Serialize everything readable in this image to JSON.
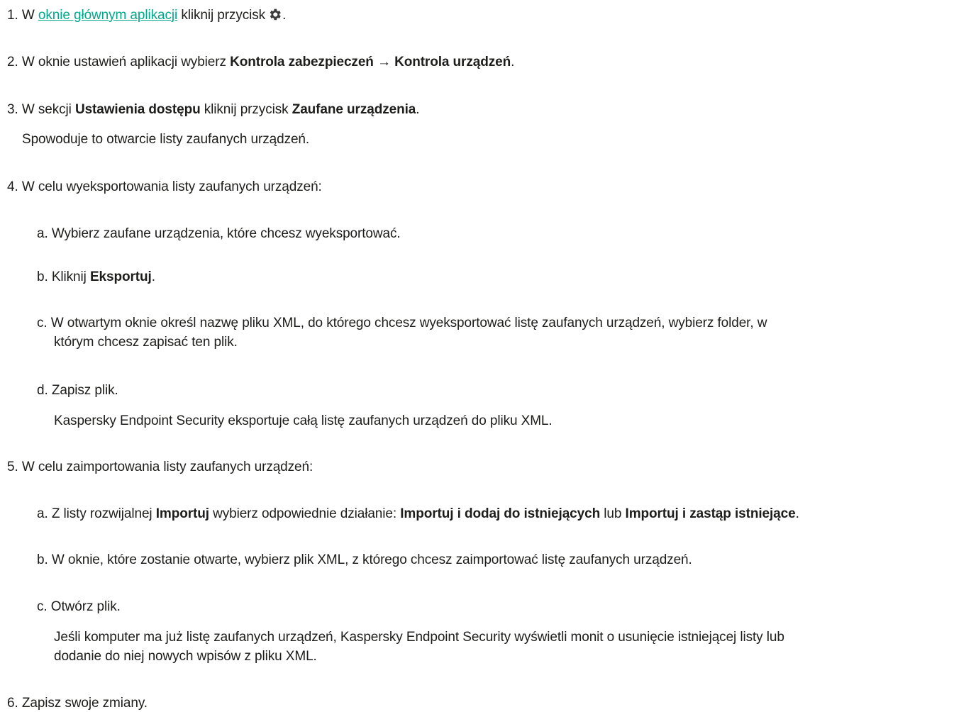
{
  "steps": {
    "s1": {
      "num": "1.",
      "pre": "W",
      "link": "oknie głównym aplikacji",
      "post": "kliknij przycisk",
      "icon": "gear-icon",
      "end": "."
    },
    "s2": {
      "num": "2.",
      "pre": "W oknie ustawień aplikacji wybierz",
      "bold1": "Kontrola zabezpieczeń → Kontrola urządzeń",
      "end": "."
    },
    "s3": {
      "num": "3.",
      "pre": "W sekcji",
      "bold1": "Ustawienia dostępu",
      "mid": "kliknij przycisk",
      "bold2": "Zaufane urządzenia",
      "end": ".",
      "note": "Spowoduje to otwarcie listy zaufanych urządzeń."
    },
    "s4": {
      "num": "4.",
      "text": "W celu wyeksportowania listy zaufanych urządzeń:",
      "a": {
        "num": "a.",
        "text": "Wybierz zaufane urządzenia, które chcesz wyeksportować."
      },
      "b": {
        "num": "b.",
        "pre": "Kliknij",
        "bold1": "Eksportuj",
        "end": "."
      },
      "c": {
        "num": "c.",
        "line1": "W otwartym oknie określ nazwę pliku XML, do którego chcesz wyeksportować listę zaufanych urządzeń, wybierz folder, w",
        "line2": "którym chcesz zapisać ten plik."
      },
      "d": {
        "num": "d.",
        "text": "Zapisz plik.",
        "note": "Kaspersky Endpoint Security eksportuje całą listę zaufanych urządzeń do pliku XML."
      }
    },
    "s5": {
      "num": "5.",
      "text": "W celu zaimportowania listy zaufanych urządzeń:",
      "a": {
        "num": "a.",
        "pre": "Z listy rozwijalnej",
        "bold1": "Importuj",
        "mid": "wybierz odpowiednie działanie:",
        "bold2": "Importuj i dodaj do istniejących",
        "mid2": "lub",
        "bold3": "Importuj i zastąp istniejące",
        "end": "."
      },
      "b": {
        "num": "b.",
        "text": "W oknie, które zostanie otwarte, wybierz plik XML, z którego chcesz zaimportować listę zaufanych urządzeń."
      },
      "c": {
        "num": "c.",
        "text": "Otwórz plik.",
        "note1": "Jeśli komputer ma już listę zaufanych urządzeń, Kaspersky Endpoint Security wyświetli monit o usunięcie istniejącej listy lub",
        "note2": "dodanie do niej nowych wpisów z pliku XML."
      }
    },
    "s6": {
      "num": "6.",
      "text": "Zapisz swoje zmiany."
    }
  },
  "colors": {
    "link": "#00a88e",
    "text": "#1d1d1b"
  }
}
